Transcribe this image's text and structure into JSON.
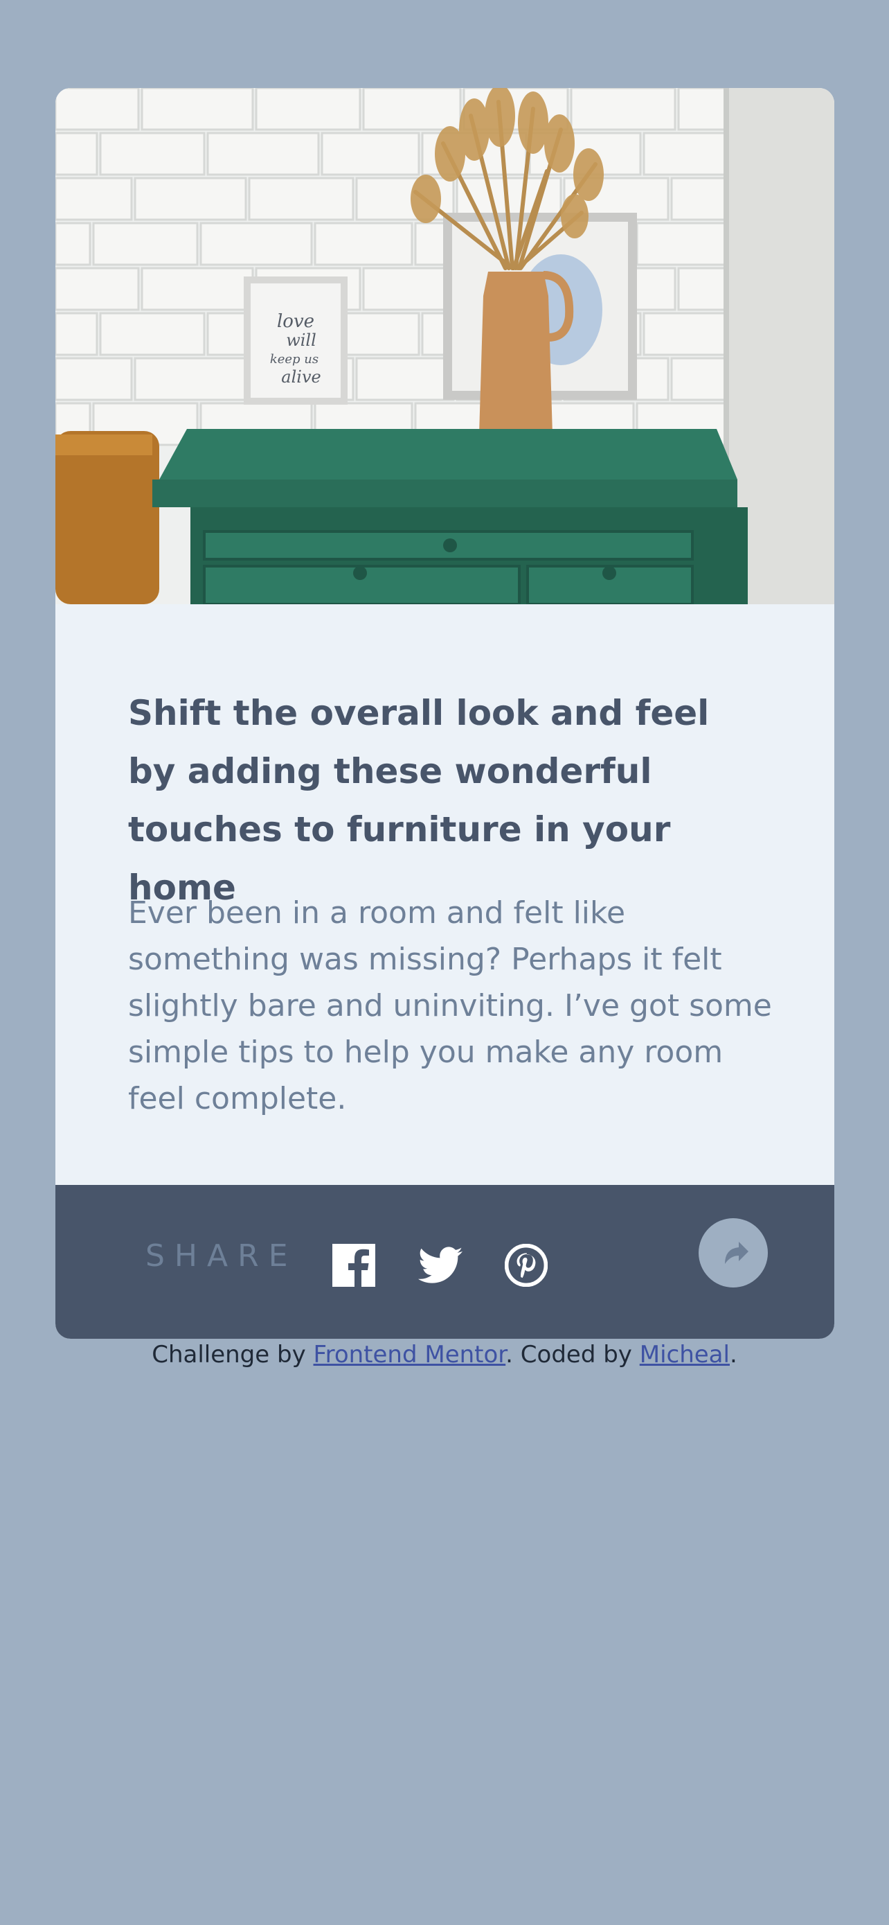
{
  "article": {
    "title": "Shift the overall look and feel by adding these wonderful touches to furniture in your home",
    "body": "Ever been in a room and felt like something was missing? Perhaps it felt slightly bare and uninviting. I’ve got some simple tips to help you make any room feel complete."
  },
  "hero_image": {
    "frame_text": [
      "love",
      "will",
      "keep us",
      "alive"
    ]
  },
  "share": {
    "label": "SHARE",
    "icons": [
      "facebook-icon",
      "twitter-icon",
      "pinterest-icon"
    ]
  },
  "share_button": {
    "icon": "share-arrow-icon"
  },
  "attribution": {
    "prefix": "Challenge by ",
    "link1": "Frontend Mentor",
    "middle": ". Coded by ",
    "link2": "Micheal",
    "suffix": "."
  },
  "colors": {
    "background": "#9eafc2",
    "card": "#ecf2f8",
    "title": "#48556a",
    "body": "#6e8098",
    "share_bar": "#48556a",
    "accent_green": "#2f7b64"
  }
}
